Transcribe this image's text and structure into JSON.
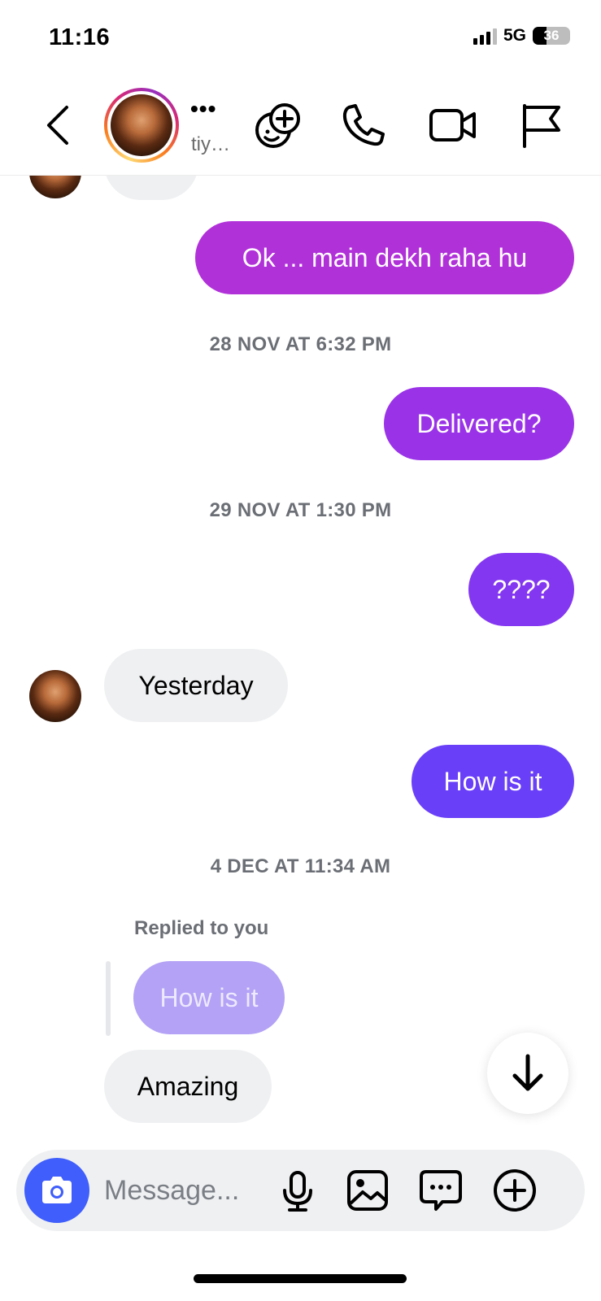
{
  "status_bar": {
    "time": "11:16",
    "network": "5G",
    "battery": "36"
  },
  "header": {
    "name_dots": "•••",
    "username": "tiy…",
    "icons": [
      "back-icon",
      "effects-icon",
      "phone-icon",
      "video-icon",
      "flag-icon"
    ]
  },
  "messages": [
    {
      "type": "outgoing",
      "text": "Ok ... main dekh raha hu"
    },
    {
      "type": "timestamp",
      "text": "28 NOV AT 6:32 PM"
    },
    {
      "type": "outgoing",
      "text": "Delivered?"
    },
    {
      "type": "timestamp",
      "text": "29 NOV AT 1:30 PM"
    },
    {
      "type": "outgoing",
      "text": "????"
    },
    {
      "type": "incoming",
      "text": "Yesterday"
    },
    {
      "type": "outgoing",
      "text": "How is it"
    },
    {
      "type": "timestamp",
      "text": "4 DEC AT 11:34 AM"
    },
    {
      "type": "reply_label",
      "text": "Replied to you"
    },
    {
      "type": "quoted",
      "text": "How is it"
    },
    {
      "type": "incoming",
      "text": "Amazing"
    }
  ],
  "composer": {
    "placeholder": "Message...",
    "icons": [
      "camera-icon",
      "microphone-icon",
      "gallery-icon",
      "sticker-icon",
      "plus-icon"
    ]
  },
  "colors": {
    "accent_blue": "#3f5efb",
    "bubble_top": "#b131d9",
    "bubble_bottom": "#6a3ff8",
    "incoming_bubble": "#eff0f2"
  }
}
